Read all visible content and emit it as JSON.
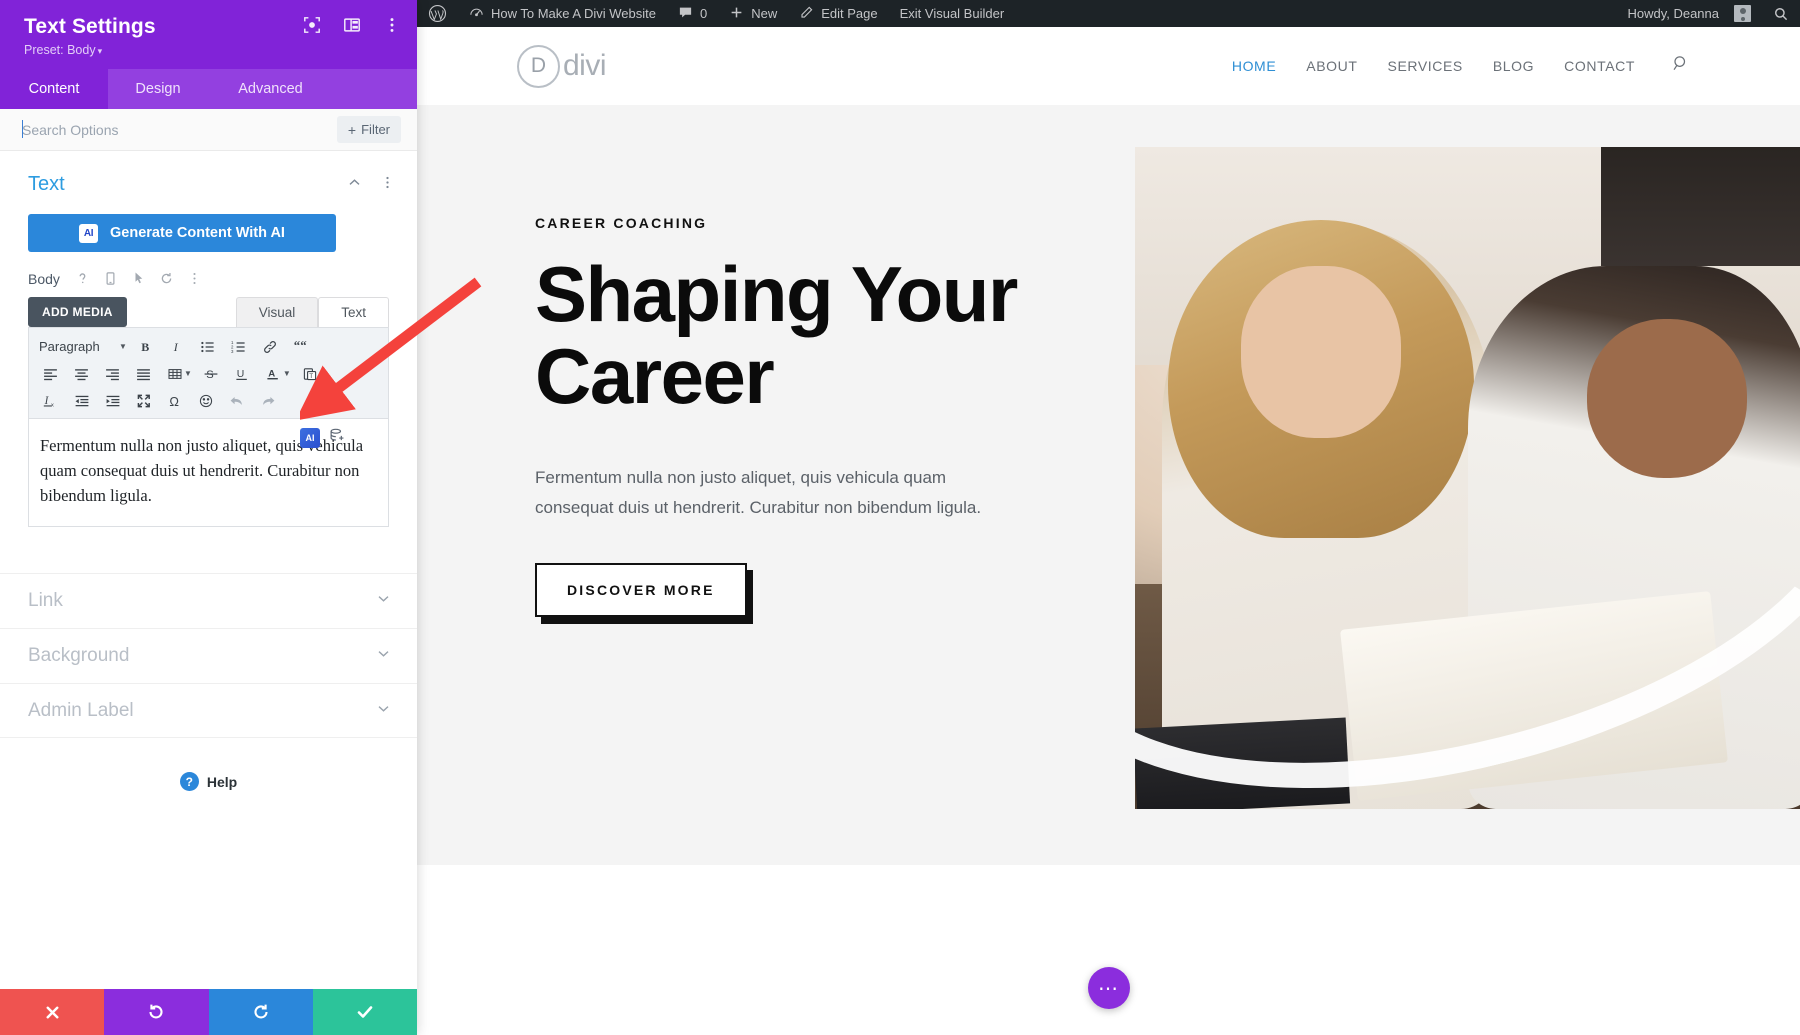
{
  "settings_panel": {
    "title": "Text Settings",
    "preset_label": "Preset: Body",
    "preset_caret": "▾",
    "header_icons": [
      "focus-target-icon",
      "layout-columns-icon",
      "kebab-menu-icon"
    ],
    "tabs": [
      {
        "label": "Content",
        "active": true
      },
      {
        "label": "Design",
        "active": false
      },
      {
        "label": "Advanced",
        "active": false
      }
    ],
    "search": {
      "placeholder": "Search Options",
      "value": ""
    },
    "filter_button": {
      "plus": "+",
      "label": "Filter"
    },
    "text_section": {
      "title": "Text",
      "ai_button": {
        "badge": "AI",
        "label": "Generate Content With AI"
      },
      "body_label": "Body",
      "body_icons": [
        "help-icon",
        "responsive-icon",
        "hover-icon",
        "reset-icon",
        "kebab-menu-icon"
      ],
      "add_media_label": "ADD MEDIA",
      "editor_tabs": [
        {
          "label": "Visual",
          "active": true
        },
        {
          "label": "Text",
          "active": false
        }
      ],
      "toolbar": {
        "format_select": "Paragraph",
        "row1": [
          "bold-icon",
          "italic-icon",
          "bulleted-list-icon",
          "numbered-list-icon",
          "link-icon",
          "blockquote-icon"
        ],
        "row2": [
          "align-left-icon",
          "align-center-icon",
          "align-right-icon",
          "align-justify-icon",
          "table-icon",
          "strikethrough-icon",
          "underline-icon",
          "text-color-icon",
          "paste-as-text-icon"
        ],
        "row3": [
          "clear-formatting-icon",
          "outdent-icon",
          "indent-icon",
          "fullscreen-icon",
          "special-character-icon",
          "emoji-icon",
          "undo-icon",
          "redo-icon"
        ]
      },
      "editor_content": "Fermentum nulla non justo aliquet, quis vehicula quam consequat duis ut hendrerit. Curabitur non bibendum ligula.",
      "inline_ai_icons": [
        "ai-badge-icon",
        "ai-rewrite-icon"
      ]
    },
    "accordions": [
      {
        "label": "Link"
      },
      {
        "label": "Background"
      },
      {
        "label": "Admin Label"
      }
    ],
    "help": {
      "badge": "?",
      "label": "Help"
    },
    "footer_buttons": [
      {
        "name": "cancel",
        "glyph": "✕",
        "color": "#ef5350"
      },
      {
        "name": "undo",
        "glyph": "↺",
        "color": "#8b2ddd"
      },
      {
        "name": "redo",
        "glyph": "↻",
        "color": "#2b87da"
      },
      {
        "name": "save",
        "glyph": "✓",
        "color": "#2cc49a"
      }
    ]
  },
  "admin_bar": {
    "wp_logo": "wordpress-logo-icon",
    "site_name": "How To Make A Divi Website",
    "comments_count": "0",
    "new_label": "New",
    "edit_page_label": "Edit Page",
    "exit_builder_label": "Exit Visual Builder",
    "howdy": "Howdy, Deanna",
    "search": "search-icon"
  },
  "site": {
    "logo": {
      "mark": "D",
      "word": "divi"
    },
    "nav": [
      {
        "label": "HOME",
        "active": true
      },
      {
        "label": "ABOUT",
        "active": false
      },
      {
        "label": "SERVICES",
        "active": false
      },
      {
        "label": "BLOG",
        "active": false
      },
      {
        "label": "CONTACT",
        "active": false
      }
    ],
    "hero": {
      "eyebrow": "CAREER COACHING",
      "title": "Shaping Your Career",
      "paragraph": "Fermentum nulla non justo aliquet, quis vehicula quam consequat duis ut hendrerit. Curabitur non bibendum ligula.",
      "cta": "DISCOVER MORE"
    },
    "fab": "⋯"
  },
  "colors": {
    "panel_purple": "#8123d8",
    "tabs_purple": "#9340e0",
    "accent_blue": "#2b87da",
    "section_title_blue": "#2d9ce0",
    "save_green": "#2cc49a",
    "cancel_red": "#ef5350",
    "annotation_red": "#f4423c",
    "admin_bar_dark": "#1d2327"
  }
}
